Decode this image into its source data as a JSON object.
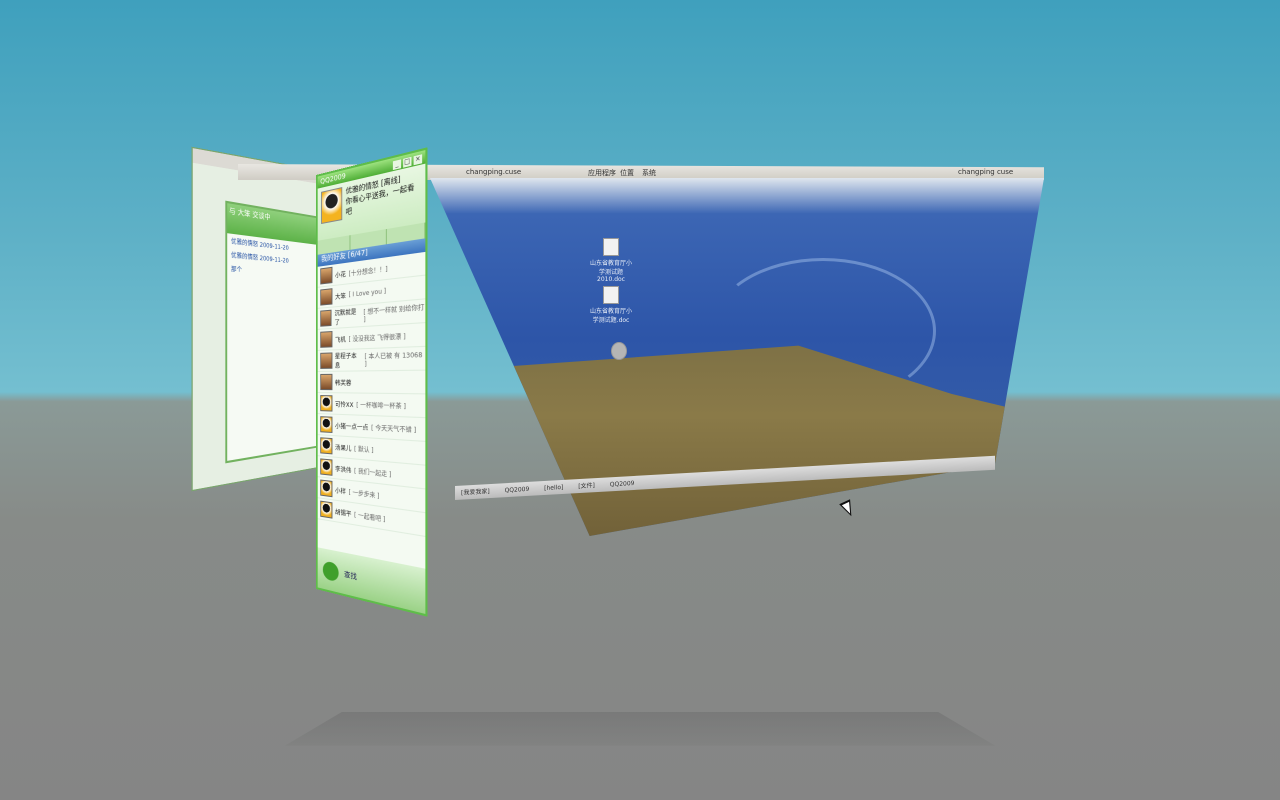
{
  "top_panel": {
    "left_items": [
      "应用程序",
      "位置",
      "系统"
    ],
    "title_fragment": "changping.cuse",
    "right_fragment": "changping cuse"
  },
  "desktop": {
    "icons": [
      {
        "label": "山东省教育厅小学测试题 2010.doc",
        "icon": "doc-file-icon"
      },
      {
        "label": "山东省教育厅小学测试题.doc",
        "icon": "doc-file-icon"
      },
      {
        "label": "",
        "icon": "ubuntu-logo-icon"
      }
    ]
  },
  "bottom_taskbar": {
    "items": [
      "[我爱我家]",
      "QQ2009",
      "[hello]",
      "[文件]",
      "QQ2009"
    ]
  },
  "qq_main": {
    "title": "QQ2009",
    "nickname": "优雅的情怒 [离线]",
    "signature": "你看心平送我，一起看吧",
    "group_name": "我的好友 [6/47]",
    "buddies": [
      {
        "name": "小花",
        "status": "[十分想念！！]",
        "face": "photo"
      },
      {
        "name": "大笨",
        "status": "[ I Love you ]",
        "face": "photo"
      },
      {
        "name": "沉默就是了",
        "status": "[ 想不一样就 别给你打 ]",
        "face": "photo"
      },
      {
        "name": "飞机",
        "status": "[ 没没我这 飞得很漂 ]",
        "face": "photo"
      },
      {
        "name": "星程子本息",
        "status": "[ 本人已被 有 13068 ]",
        "face": "photo"
      },
      {
        "name": "韩芙蓉",
        "status": "",
        "face": "photo"
      },
      {
        "name": "可怜XX",
        "status": "[ 一杯咖啡一杯茶 ]",
        "face": "qq"
      },
      {
        "name": "小猪一点一点",
        "status": "[ 今天天气不错 ]",
        "face": "qq"
      },
      {
        "name": "汤果儿",
        "status": "[ 默认 ]",
        "face": "qq"
      },
      {
        "name": "李洪伟",
        "status": "[ 我们一起走 ]",
        "face": "qq"
      },
      {
        "name": "小样",
        "status": "[ 一步步来 ]",
        "face": "qq"
      },
      {
        "name": "胡锡平",
        "status": "[ 一起看吧 ]",
        "face": "qq"
      }
    ],
    "search_label": "查找"
  },
  "chat_window": {
    "title": "与 大笨 交谈中",
    "message_1": "优雅的情怒 2009-11-20",
    "message_2": "优雅的情怒 2009-11-20",
    "reply": "那个"
  },
  "colors": {
    "qq_green": "#5fbd4a",
    "desktop_blue": "#2d55a8",
    "sand": "#8a7a48"
  }
}
